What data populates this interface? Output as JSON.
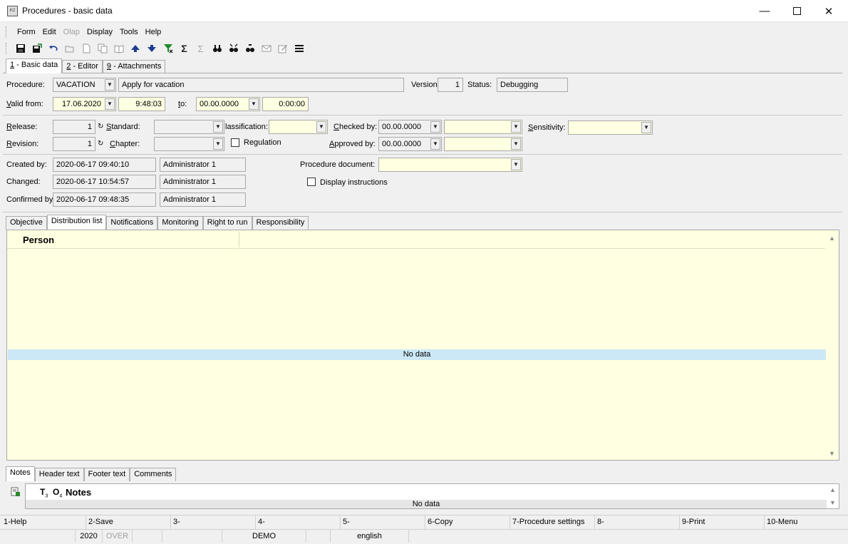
{
  "window": {
    "title": "Procedures - basic data",
    "app_icon_text": "K2"
  },
  "menu": {
    "items": [
      {
        "label": "Form",
        "disabled": false
      },
      {
        "label": "Edit",
        "disabled": false
      },
      {
        "label": "Olap",
        "disabled": true
      },
      {
        "label": "Display",
        "disabled": false
      },
      {
        "label": "Tools",
        "disabled": false
      },
      {
        "label": "Help",
        "disabled": false
      }
    ]
  },
  "toolbar": {
    "icons": [
      "save-icon",
      "save-as-icon",
      "undo-icon",
      "open-icon",
      "new-icon",
      "copy-icon",
      "book-icon",
      "arrow-up-icon",
      "arrow-down-icon",
      "filter-icon",
      "sum-icon",
      "sum-filter-icon",
      "binoculars-icon",
      "find-next-icon",
      "find-icon",
      "mail-icon",
      "edit-icon",
      "menu-lines-icon"
    ]
  },
  "top_tabs": [
    {
      "key": "1",
      "label": " - Basic data"
    },
    {
      "key": "2",
      "label": " - Editor"
    },
    {
      "key": "9",
      "label": " - Attachments"
    }
  ],
  "form": {
    "procedure_label": "Procedure:",
    "procedure_value": "VACATION",
    "procedure_name": "Apply for vacation",
    "version_label": "Version:",
    "version_value": "1",
    "status_label": "Status:",
    "status_value": "Debugging",
    "valid_from_label_prefix": "V",
    "valid_from_label_rest": "alid from:",
    "valid_from_date": "17.06.2020",
    "valid_from_time": "9:48:03",
    "to_label_prefix": "t",
    "to_label_rest": "o:",
    "to_date": "00.00.0000",
    "to_time": "0:00:00",
    "release_label_prefix": "R",
    "release_label_rest": "elease:",
    "release_value": "1",
    "standard_label_prefix": "S",
    "standard_label_rest": "tandard:",
    "classification_label": "lassification:",
    "checked_by_label_prefix": "C",
    "checked_by_label_rest": "hecked by:",
    "checked_by_date": "00.00.0000",
    "sensitivity_label_prefix": "S",
    "sensitivity_label_rest": "ensitivity:",
    "revision_label_prefix": "R",
    "revision_label_rest": "evision:",
    "revision_value": "1",
    "chapter_label_prefix": "C",
    "chapter_label_rest": "hapter:",
    "regulation_label": "Regulation",
    "approved_by_label_prefix": "A",
    "approved_by_label_rest": "pproved by:",
    "approved_by_date": "00.00.0000",
    "created_by_label": "Created by:",
    "created_by_date": "2020-06-17 09:40:10",
    "created_by_user": "Administrator 1",
    "changed_label": "Changed:",
    "changed_date": "2020-06-17 10:54:57",
    "changed_user": "Administrator 1",
    "confirmed_by_label": "Confirmed by",
    "confirmed_by_date": "2020-06-17 09:48:35",
    "confirmed_by_user": "Administrator 1",
    "procedure_document_label": "Procedure document:",
    "display_instructions_label": "Display instructions"
  },
  "mid_tabs": [
    {
      "label": "Objective"
    },
    {
      "label": "Distribution list"
    },
    {
      "label": "Notifications"
    },
    {
      "label": "Monitoring"
    },
    {
      "label": "Right to run"
    },
    {
      "label": "Responsibility"
    }
  ],
  "distribution_grid": {
    "column_header": "Person",
    "no_data": "No data"
  },
  "bottom_tabs": [
    {
      "label": "Notes"
    },
    {
      "label": "Header text"
    },
    {
      "label": "Footer text"
    },
    {
      "label": "Comments"
    }
  ],
  "notes_grid": {
    "col_t": "T",
    "col_t_sub": "3",
    "col_o": "O",
    "col_o_sub": "4",
    "column_header": "Notes",
    "no_data": "No data"
  },
  "function_keys": [
    "1-Help",
    "2-Save",
    "3-",
    "4-",
    "5-",
    "6-Copy",
    "7-Procedure settings",
    "8-",
    "9-Print",
    "10-Menu"
  ],
  "status_bar": {
    "year": "2020",
    "over": "OVER",
    "db": "DEMO",
    "language": "english"
  }
}
